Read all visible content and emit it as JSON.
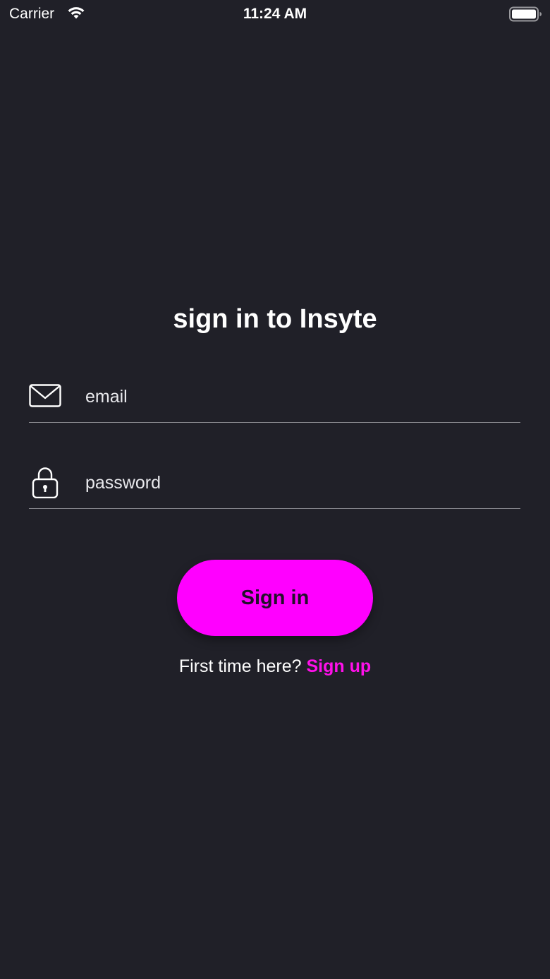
{
  "status_bar": {
    "carrier": "Carrier",
    "time": "11:24 AM",
    "wifi_icon": "wifi-icon",
    "battery_icon": "battery-icon"
  },
  "title": "sign in to Insyte",
  "form": {
    "email": {
      "placeholder": "email",
      "value": "",
      "icon": "envelope-icon"
    },
    "password": {
      "placeholder": "password",
      "value": "",
      "icon": "lock-icon"
    },
    "submit_label": "Sign in"
  },
  "signup": {
    "prompt": "First time here?",
    "link_label": "Sign up"
  },
  "colors": {
    "background": "#202028",
    "accent": "#ff00ff",
    "link": "#ff10ea",
    "text": "#ffffff"
  }
}
